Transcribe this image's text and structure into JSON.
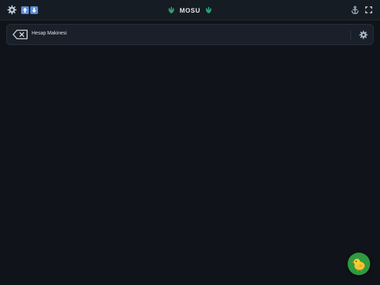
{
  "app": {
    "title": "MOSU",
    "background_color": "#10141a",
    "header_color": "#161c23"
  },
  "header": {
    "left_icons": [
      "gear-icon",
      "arrow-up-icon",
      "arrow-down-icon"
    ],
    "brand_icons": [
      "peacock-icon",
      "peacock-icon"
    ],
    "right_icons": [
      "anchor-icon",
      "fullscreen-icon"
    ]
  },
  "tool_card": {
    "label": "Hesap Makinesi",
    "icon": "backspace-icon",
    "settings_icon": "gear-icon"
  },
  "fab": {
    "icon": "chick-icon",
    "color": "#2f9a3f"
  }
}
